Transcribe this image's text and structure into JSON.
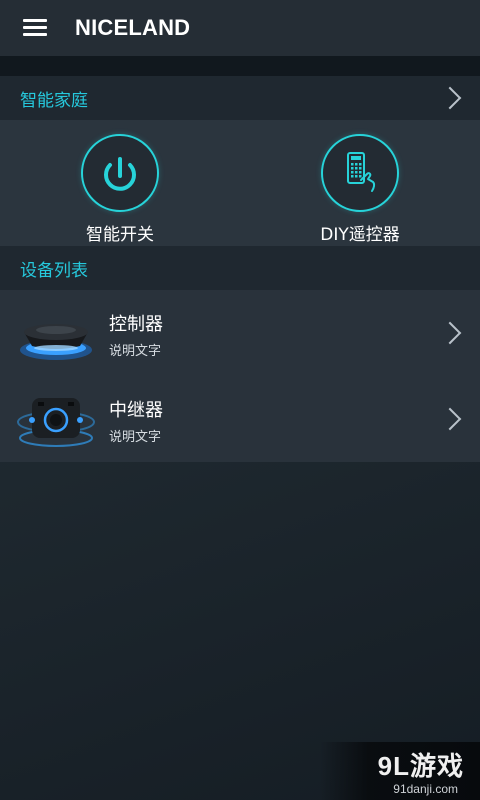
{
  "app": {
    "title": "NICELAND"
  },
  "smart_home": {
    "header": "智能家庭",
    "items": [
      {
        "label": "智能开关",
        "icon": "power-icon"
      },
      {
        "label": "DIY遥控器",
        "icon": "remote-icon"
      }
    ]
  },
  "device_list": {
    "header": "设备列表",
    "devices": [
      {
        "name": "控制器",
        "desc": "说明文字"
      },
      {
        "name": "中继器",
        "desc": "说明文字"
      }
    ]
  },
  "watermark": {
    "logo": "9L游戏",
    "url": "91danji.com"
  },
  "colors": {
    "accent": "#26c9dd",
    "appbar": "#252d35",
    "panel": "#2b353e"
  }
}
